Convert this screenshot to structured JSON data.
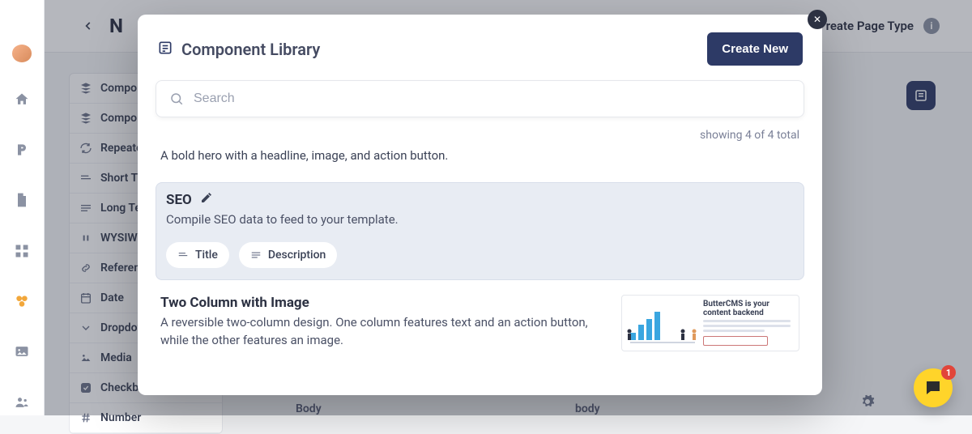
{
  "topbar": {
    "title_partial": "N",
    "right_label": "reate Page Type",
    "body_label_l": "Body",
    "body_label_r": "body"
  },
  "nav": {
    "icons": [
      "avatar",
      "home",
      "blog",
      "page",
      "collection",
      "media",
      "image",
      "users"
    ]
  },
  "sidebar_fields": [
    {
      "icon": "layers",
      "label": "Compo"
    },
    {
      "icon": "layers-plus",
      "label": "Compo"
    },
    {
      "icon": "repeat",
      "label": "Repeate"
    },
    {
      "icon": "short-text",
      "label": "Short Te"
    },
    {
      "icon": "long-text",
      "label": "Long Te"
    },
    {
      "icon": "quote",
      "label": "WYSIWY"
    },
    {
      "icon": "link",
      "label": "Referen"
    },
    {
      "icon": "calendar",
      "label": "Date"
    },
    {
      "icon": "chevron-down",
      "label": "Dropdov"
    },
    {
      "icon": "image",
      "label": "Media"
    },
    {
      "icon": "check-square",
      "label": "Checkbo"
    },
    {
      "icon": "hash",
      "label": "Number"
    }
  ],
  "modal": {
    "title": "Component Library",
    "create_label": "Create New",
    "search_placeholder": "Search",
    "showing_text": "showing 4 of 4 total"
  },
  "components": [
    {
      "kind": "simple",
      "description": "A bold hero with a headline, image, and action button."
    },
    {
      "kind": "selected",
      "title": "SEO",
      "description": "Compile SEO data to feed to your template.",
      "chips": [
        "Title",
        "Description"
      ]
    },
    {
      "kind": "twocol",
      "title": "Two Column with Image",
      "description": "A reversible two-column design. One column features text and an action button, while the other features an image.",
      "thumb_heading": "ButterCMS is your content backend"
    }
  ],
  "help": {
    "badge": "1"
  }
}
